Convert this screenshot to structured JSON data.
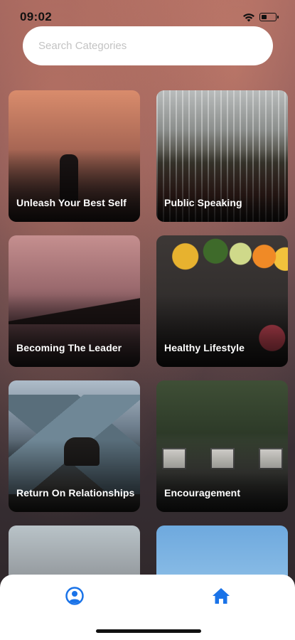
{
  "status_bar": {
    "time": "09:02"
  },
  "search": {
    "placeholder": "Search Categories"
  },
  "categories": [
    {
      "label": "Unleash Your Best Self"
    },
    {
      "label": "Public Speaking"
    },
    {
      "label": "Becoming The Leader"
    },
    {
      "label": "Healthy Lifestyle"
    },
    {
      "label": "Return On Relationships"
    },
    {
      "label": "Encouragement"
    },
    {
      "label": ""
    },
    {
      "label": ""
    }
  ],
  "bottom_nav": {
    "profile_icon": "user-circle-icon",
    "home_icon": "home-icon"
  },
  "colors": {
    "accent": "#1a73e8",
    "search_bg": "#ffffff",
    "placeholder": "#c3c3c3"
  }
}
